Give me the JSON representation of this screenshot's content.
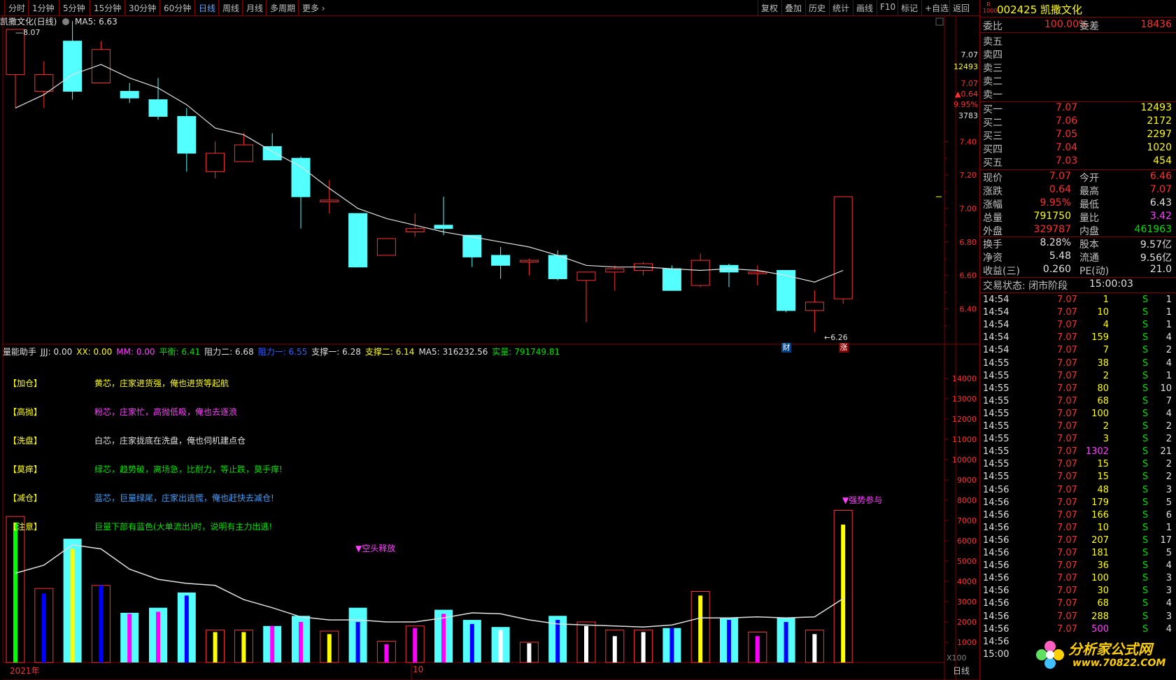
{
  "toolbar": {
    "periods": [
      "分时",
      "1分钟",
      "5分钟",
      "15分钟",
      "30分钟",
      "60分钟",
      "日线",
      "周线",
      "月线",
      "多周期",
      "更多"
    ],
    "active": "日线",
    "right_tools": [
      "复权",
      "叠加",
      "历史",
      "统计",
      "画线",
      "F10",
      "标记",
      "+自选",
      "返回"
    ]
  },
  "main": {
    "title": "凯撒文化(日线)",
    "ma_label": "MA5: 6.63",
    "max_marker": "8.07",
    "min_marker": "6.26",
    "badge_cai": "财",
    "badge_zhang": "涨",
    "year_label": "2021年",
    "month_label": "10",
    "period_label": "日线",
    "unit_label": "X100",
    "axis_quote": [
      "7.07",
      "12493",
      "7.07",
      "▲0.64",
      "9.95%",
      "3783"
    ]
  },
  "indicator": {
    "legend": [
      {
        "t": "量能助手",
        "c": "#e0e0e0"
      },
      {
        "t": "JJJ: 0.00",
        "c": "#e0e0e0"
      },
      {
        "t": "XX: 0.00",
        "c": "#ffff00"
      },
      {
        "t": "MM: 0.00",
        "c": "#ff40ff"
      },
      {
        "t": "平衡: 6.41",
        "c": "#00e000"
      },
      {
        "t": "阻力二: 6.68",
        "c": "#e0e0e0"
      },
      {
        "t": "阻力一: 6.55",
        "c": "#3060ff"
      },
      {
        "t": "支撑一: 6.28",
        "c": "#e0e0e0"
      },
      {
        "t": "支撑二: 6.14",
        "c": "#ffff00"
      },
      {
        "t": "MA5: 316232.56",
        "c": "#e0e0e0"
      },
      {
        "t": "实量: 791749.81",
        "c": "#00e000"
      }
    ],
    "notes": [
      {
        "label": "【加仓】",
        "text": "黄芯，庄家进货强，俺也进货等起航",
        "color": "#ffff00"
      },
      {
        "label": "【高抛】",
        "text": "粉芯，庄家忙，高抛低吸，俺也去逐浪",
        "color": "#ff40ff"
      },
      {
        "label": "【洗盘】",
        "text": "白芯，庄家拢底在洗盘，俺也伺机建点仓",
        "color": "#e0e0e0"
      },
      {
        "label": "【莫痒】",
        "text": "绿芯，趋势破，离场急，比耐力，等止跌，莫手痒!",
        "color": "#00e000"
      },
      {
        "label": "【减仓】",
        "text": "蓝芯，巨量绿尾，庄家出逃慌，俺也赶快去减仓!",
        "color": "#40a0ff"
      },
      {
        "label": "【注意】",
        "text": "巨量下部有蓝色(大单流出)时，说明有主力出逃!",
        "color": "#00e000"
      }
    ],
    "signal_short": "▼空头释放",
    "signal_strong": "▼强势参与"
  },
  "quote": {
    "code": "002425",
    "name": "凯撒文化",
    "r_label": "R",
    "r_code": "1000",
    "webi_label": "委比",
    "webi_val": "100.00%",
    "weicha_label": "委差",
    "weicha_val": "18436",
    "sell": [
      {
        "label": "卖五",
        "price": "",
        "vol": ""
      },
      {
        "label": "卖四",
        "price": "",
        "vol": ""
      },
      {
        "label": "卖三",
        "price": "",
        "vol": ""
      },
      {
        "label": "卖二",
        "price": "",
        "vol": ""
      },
      {
        "label": "卖一",
        "price": "",
        "vol": ""
      }
    ],
    "buy": [
      {
        "label": "买一",
        "price": "7.07",
        "vol": "12493"
      },
      {
        "label": "买二",
        "price": "7.06",
        "vol": "2172"
      },
      {
        "label": "买三",
        "price": "7.05",
        "vol": "2297"
      },
      {
        "label": "买四",
        "price": "7.04",
        "vol": "1020"
      },
      {
        "label": "买五",
        "price": "7.03",
        "vol": "454"
      }
    ],
    "stats1": [
      {
        "l1": "现价",
        "v1": "7.07",
        "c1": "red",
        "l2": "今开",
        "v2": "6.46",
        "c2": "red"
      },
      {
        "l1": "涨跌",
        "v1": "0.64",
        "c1": "red",
        "l2": "最高",
        "v2": "7.07",
        "c2": "red"
      },
      {
        "l1": "涨幅",
        "v1": "9.95%",
        "c1": "red",
        "l2": "最低",
        "v2": "6.43",
        "c2": "wht"
      },
      {
        "l1": "总量",
        "v1": "791750",
        "c1": "yel",
        "l2": "量比",
        "v2": "3.42",
        "c2": "mag"
      },
      {
        "l1": "外盘",
        "v1": "329787",
        "c1": "red",
        "l2": "内盘",
        "v2": "461963",
        "c2": "grn"
      }
    ],
    "stats2": [
      {
        "l1": "换手",
        "v1": "8.28%",
        "l2": "股本",
        "v2": "9.57亿"
      },
      {
        "l1": "净资",
        "v1": "5.48",
        "l2": "流通",
        "v2": "9.56亿"
      },
      {
        "l1": "收益(三)",
        "v1": "0.260",
        "l2": "PE(动)",
        "v2": "21.0"
      }
    ],
    "status_label": "交易状态: 闭市阶段",
    "status_time": "15:00:03",
    "ticks": [
      [
        "14:54",
        "7.07",
        "1",
        "S",
        "1"
      ],
      [
        "14:54",
        "7.07",
        "10",
        "S",
        "1"
      ],
      [
        "14:54",
        "7.07",
        "4",
        "S",
        "1"
      ],
      [
        "14:54",
        "7.07",
        "159",
        "S",
        "4"
      ],
      [
        "14:54",
        "7.07",
        "7",
        "S",
        "2"
      ],
      [
        "14:55",
        "7.07",
        "38",
        "S",
        "4"
      ],
      [
        "14:55",
        "7.07",
        "2",
        "S",
        "1"
      ],
      [
        "14:55",
        "7.07",
        "80",
        "S",
        "10"
      ],
      [
        "14:55",
        "7.07",
        "68",
        "S",
        "7"
      ],
      [
        "14:55",
        "7.07",
        "100",
        "S",
        "4"
      ],
      [
        "14:55",
        "7.07",
        "2",
        "S",
        "2"
      ],
      [
        "14:55",
        "7.07",
        "3",
        "S",
        "2"
      ],
      [
        "14:55",
        "7.07",
        "1302",
        "S",
        "21"
      ],
      [
        "14:55",
        "7.07",
        "15",
        "S",
        "2"
      ],
      [
        "14:55",
        "7.07",
        "15",
        "S",
        "2"
      ],
      [
        "14:56",
        "7.07",
        "48",
        "S",
        "3"
      ],
      [
        "14:56",
        "7.07",
        "179",
        "S",
        "5"
      ],
      [
        "14:56",
        "7.07",
        "166",
        "S",
        "6"
      ],
      [
        "14:56",
        "7.07",
        "10",
        "S",
        "1"
      ],
      [
        "14:56",
        "7.07",
        "207",
        "S",
        "17"
      ],
      [
        "14:56",
        "7.07",
        "181",
        "S",
        "5"
      ],
      [
        "14:56",
        "7.07",
        "36",
        "S",
        "4"
      ],
      [
        "14:56",
        "7.07",
        "100",
        "S",
        "3"
      ],
      [
        "14:56",
        "7.07",
        "30",
        "S",
        "3"
      ],
      [
        "14:56",
        "7.07",
        "68",
        "S",
        "4"
      ],
      [
        "14:56",
        "7.07",
        "288",
        "S",
        "3"
      ],
      [
        "14:56",
        "7.07",
        "500",
        "S",
        "4"
      ],
      [
        "14:56",
        "",
        "",
        "",
        ""
      ],
      [
        "15:00",
        "",
        "",
        "",
        ""
      ]
    ],
    "watermark_brand": "分析家公式网",
    "watermark_url": "www.70822.COM"
  },
  "chart_data": [
    {
      "type": "candlestick",
      "title": "凯撒文化(日线)",
      "ylim": [
        6.26,
        8.07
      ],
      "yticks": [
        "7.40",
        "7.20",
        "7.00",
        "6.80",
        "6.60",
        "6.40"
      ],
      "candles": [
        {
          "o": 7.8,
          "c": 8.07,
          "h": 8.07,
          "l": 7.6
        },
        {
          "o": 7.7,
          "c": 7.8,
          "h": 7.88,
          "l": 7.6
        },
        {
          "o": 8.0,
          "c": 7.7,
          "h": 8.12,
          "l": 7.65
        },
        {
          "o": 7.75,
          "c": 7.95,
          "h": 8.0,
          "l": 7.75
        },
        {
          "o": 7.7,
          "c": 7.66,
          "h": 7.75,
          "l": 7.63
        },
        {
          "o": 7.65,
          "c": 7.55,
          "h": 7.78,
          "l": 7.53
        },
        {
          "o": 7.55,
          "c": 7.33,
          "h": 7.6,
          "l": 7.22
        },
        {
          "o": 7.22,
          "c": 7.33,
          "h": 7.4,
          "l": 7.18
        },
        {
          "o": 7.28,
          "c": 7.38,
          "h": 7.45,
          "l": 7.28
        },
        {
          "o": 7.37,
          "c": 7.29,
          "h": 7.45,
          "l": 7.29
        },
        {
          "o": 7.3,
          "c": 7.07,
          "h": 7.31,
          "l": 6.88
        },
        {
          "o": 7.04,
          "c": 7.05,
          "h": 7.17,
          "l": 6.97
        },
        {
          "o": 6.97,
          "c": 6.65,
          "h": 6.97,
          "l": 6.65
        },
        {
          "o": 6.72,
          "c": 6.82,
          "h": 6.82,
          "l": 6.72
        },
        {
          "o": 6.86,
          "c": 6.88,
          "h": 6.97,
          "l": 6.83
        },
        {
          "o": 6.9,
          "c": 6.88,
          "h": 7.07,
          "l": 6.84
        },
        {
          "o": 6.84,
          "c": 6.71,
          "h": 6.84,
          "l": 6.65
        },
        {
          "o": 6.72,
          "c": 6.66,
          "h": 6.77,
          "l": 6.58
        },
        {
          "o": 6.68,
          "c": 6.69,
          "h": 6.7,
          "l": 6.6
        },
        {
          "o": 6.72,
          "c": 6.58,
          "h": 6.75,
          "l": 6.57
        },
        {
          "o": 6.57,
          "c": 6.62,
          "h": 6.62,
          "l": 6.32
        },
        {
          "o": 6.62,
          "c": 6.64,
          "h": 6.66,
          "l": 6.51
        },
        {
          "o": 6.63,
          "c": 6.67,
          "h": 6.68,
          "l": 6.6
        },
        {
          "o": 6.64,
          "c": 6.51,
          "h": 6.66,
          "l": 6.51
        },
        {
          "o": 6.54,
          "c": 6.69,
          "h": 6.73,
          "l": 6.53
        },
        {
          "o": 6.66,
          "c": 6.62,
          "h": 6.67,
          "l": 6.53
        },
        {
          "o": 6.61,
          "c": 6.62,
          "h": 6.66,
          "l": 6.54
        },
        {
          "o": 6.63,
          "c": 6.39,
          "h": 6.63,
          "l": 6.38
        },
        {
          "o": 6.39,
          "c": 6.44,
          "h": 6.51,
          "l": 6.26
        },
        {
          "o": 6.46,
          "c": 7.07,
          "h": 7.07,
          "l": 6.43
        }
      ],
      "ma5": [
        7.6,
        7.68,
        7.8,
        7.86,
        7.78,
        7.72,
        7.62,
        7.48,
        7.44,
        7.34,
        7.25,
        7.12,
        7.0,
        6.94,
        6.9,
        6.86,
        6.83,
        6.8,
        6.77,
        6.72,
        6.66,
        6.65,
        6.65,
        6.64,
        6.63,
        6.64,
        6.63,
        6.6,
        6.56,
        6.63
      ]
    },
    {
      "type": "bar",
      "title": "量能助手",
      "ylim": [
        0,
        15000
      ],
      "yticks": [
        "14000",
        "13000",
        "12000",
        "11000",
        "10000",
        "9000",
        "8000",
        "7000",
        "6000",
        "5000",
        "4000",
        "3000",
        "2000",
        "1000"
      ],
      "unit": "X100",
      "volumes": [
        7200,
        3650,
        6100,
        3800,
        2450,
        2700,
        3450,
        1600,
        1600,
        1800,
        2300,
        1550,
        2700,
        1050,
        1800,
        2600,
        2100,
        1750,
        1000,
        2300,
        2000,
        1600,
        1600,
        1700,
        3500,
        2200,
        1500,
        2200,
        1600,
        7500
      ],
      "core": [
        6900,
        3400,
        5600,
        3800,
        2400,
        2500,
        3300,
        1500,
        1500,
        1800,
        2000,
        1400,
        2000,
        900,
        1700,
        2400,
        1900,
        1600,
        950,
        2100,
        1800,
        1300,
        1500,
        1700,
        3300,
        2100,
        1300,
        2000,
        1400,
        6800
      ],
      "core_colors": [
        "#00ff00",
        "#0000ff",
        "#ffff00",
        "#0000ff",
        "#ff00ff",
        "#ff00ff",
        "#0000ff",
        "#ffff00",
        "#ffff00",
        "#ff00ff",
        "#ff00ff",
        "#ffff00",
        "#0000ff",
        "#ff00ff",
        "#ff00ff",
        "#ff00ff",
        "#0000ff",
        "#ffffff",
        "#ffffff",
        "#0000ff",
        "#ffffff",
        "#ffffff",
        "#ffffff",
        "#0000ff",
        "#ffff00",
        "#0000ff",
        "#ff00ff",
        "#0000ff",
        "#ffffff",
        "#ffff00"
      ],
      "ma5_vol": [
        4400,
        4800,
        5800,
        5600,
        4600,
        4100,
        3900,
        3800,
        3100,
        2700,
        2250,
        2100,
        2100,
        2000,
        2000,
        2200,
        2450,
        2400,
        2100,
        1900,
        1850,
        1800,
        1750,
        1850,
        2200,
        2200,
        2250,
        2200,
        2250,
        3150
      ]
    }
  ]
}
